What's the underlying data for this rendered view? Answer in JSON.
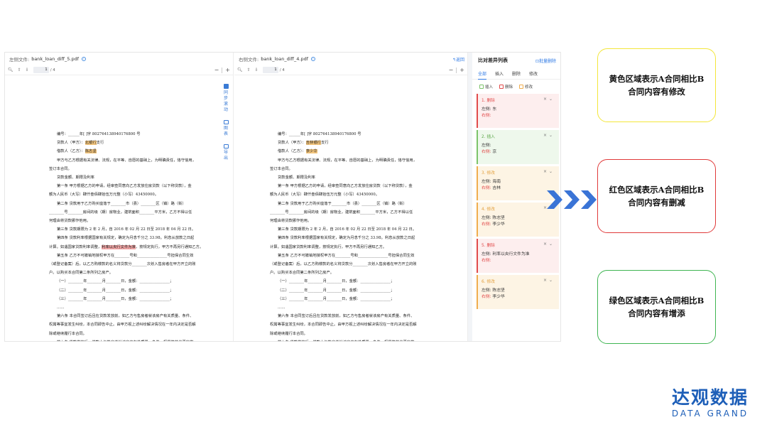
{
  "left_pane": {
    "label": "左侧文件:",
    "file_name": "bank_loan_diff_5.pdf",
    "page_current": "1",
    "page_total": "/ 4",
    "lines": [
      {
        "t": "编号：______年[ ]字 802764138940176800 号",
        "i": true
      },
      {
        "t": "贷款人（甲方）：",
        "hl": "北银行",
        "hlc": "y",
        "t2": "支行",
        "i": true
      },
      {
        "t": "借款人（乙方）：",
        "hl": "陈志坚",
        "hlc": "y",
        "t2": "",
        "i": true
      },
      {
        "t": "甲方与乙方根据有关法律、法规，在平等、自愿的基础上，为明确责任，恪守信用，",
        "i": true
      },
      {
        "t": "签订本合同。",
        "i": false
      },
      {
        "t": "贷款金额、期限及利率",
        "i": true
      },
      {
        "t": "第一条 甲方根据乙方的申请，经审查同意向乙方发放住房贷款（以下称贷款），金",
        "i": true
      },
      {
        "t": "额为人民币（大写）肆仟叁佰肆拾伍万元整（小写）43450000。",
        "i": false
      },
      {
        "t": "第二条 贷款用于乙方购买座落于________市（县）________区（镇）路（街）",
        "i": true
      },
      {
        "t": "________号________房间的级（期）房物业，建筑面积________平方米，乙方不得以任",
        "i": false
      },
      {
        "t": "何理由将贷款挪作他用。",
        "i": false
      },
      {
        "t": "第三条 贷款期限为 2 年 2 月，自 2016 年 02 月 22 日至 2018 年 04 月 22 日。",
        "i": true
      },
      {
        "t": "第四条 贷款利率根据国家有关规定，确定为月息千分之 33.98。利息从放款之日起",
        "i": true
      },
      {
        "t": "计算。如遇国家贷款利率调整，",
        "hl": "利率以央行文件为准",
        "hlc": "r",
        "t2": "，按规定执行，甲方不再另行通知乙方。",
        "i": false
      },
      {
        "t": "第五条 乙方不可撤销地授权甲方在________号和________________号担保合同生效",
        "i": true
      },
      {
        "t": "（或登记备案）后，以乙方购楼款的名义将贷款分________次划入售房者在甲方开立的账",
        "i": false
      },
      {
        "t": "户。以购买本合同第二条所列之房产。",
        "i": false
      },
      {
        "t": "（一）________年________月________日，金额：________________；",
        "i": true
      },
      {
        "t": "（二）________年________月________日，金额：________________；",
        "i": true
      },
      {
        "t": "（三）________年________月________日，金额：________________；",
        "i": true
      },
      {
        "t": "……",
        "i": true
      },
      {
        "t": "第六条 本合同签订后且在贷款发放前，如乙方与售房者就该房产有关质量、条件、",
        "i": true
      },
      {
        "t": "权属等事宜发生纠纷，本合同即告中止。由甲方视上述纠纷解决情况在一年内决定是否解",
        "i": false
      },
      {
        "t": "除或继续履行本合同。",
        "i": false
      },
      {
        "t": "第七条 贷款发放后，借款人与售房者就该房产有关质量、条件、权属等其他事宜发",
        "i": true
      },
      {
        "t": "生的任何纠纷，均与贷款人无关，借款合同应正常履行。",
        "i": false
      },
      {
        "t": "贷款的归还",
        "i": true
      },
      {
        "t": "第八条 甲乙双方商定，自 2018 年 11 月 10 日起乙方用下列方式归还贷款本息：",
        "i": true
      }
    ]
  },
  "right_pane": {
    "label": "右侧文件:",
    "file_name": "bank_loan_diff_4.pdf",
    "back_label": "返回",
    "page_current": "1",
    "page_total": "/ 4",
    "lines": [
      {
        "t": "编号：______年[ ]字 802764138940176800 号",
        "i": true
      },
      {
        "t": "贷款人（甲方）：",
        "hl": "吉林银行",
        "hlc": "y",
        "t2": "支行",
        "i": true
      },
      {
        "t": "借款人（乙方）：",
        "hl": "李少华",
        "hlc": "y",
        "t2": "",
        "i": true
      },
      {
        "t": "甲方与乙方根据有关法律、法规，在平等、自愿的基础上，为明确责任，恪守信用，",
        "i": true
      },
      {
        "t": "签订本合同。",
        "i": false
      },
      {
        "t": "贷款金额、期限及利率",
        "i": true
      },
      {
        "t": "第一条 甲方根据乙方的申请，经审查同意向乙方发放住房贷款（以下称贷款），金",
        "i": true
      },
      {
        "t": "额为人民币（大写）肆仟叁佰肆拾伍万元整（小写）43450000。",
        "i": false
      },
      {
        "t": "第二条 贷款用于乙方购买座落于________市（县）________区（镇）路（街）",
        "i": true
      },
      {
        "t": "________号________房间的级（期）房物业，建筑面积________平方米，乙方不得以任",
        "i": false
      },
      {
        "t": "何理由将贷款挪作他用。",
        "i": false
      },
      {
        "t": "第三条 贷款期限为 2 年 2 月，自 2016 年 02 月 22 日至 2018 年 04 月 22 日。",
        "i": true
      },
      {
        "t": "第四条 贷款利率根据国家有关规定，确定为月息千分之 33.98。利息从放款之日起",
        "i": true
      },
      {
        "t": "计算。如遇国家贷款利率调整，按规定执行，甲方不再另行通知乙方。",
        "i": false
      },
      {
        "t": "第五条 乙方不可撤销地授权甲方在________号和________________号担保合同生效",
        "i": true
      },
      {
        "t": "（或登记备案）后，以乙方购楼款的名义将贷款分________次划入售房者在甲方开立的账",
        "i": false
      },
      {
        "t": "户。以购买本合同第二条所列之房产。",
        "i": false
      },
      {
        "t": "（一）________年________月________日，金额：________________；",
        "i": true
      },
      {
        "t": "（二）________年________月________日，金额：________________；",
        "i": true
      },
      {
        "t": "（三）________年________月________日，金额：________________；",
        "i": true
      },
      {
        "t": "……",
        "i": true
      },
      {
        "t": "第六条 本合同签订后且在贷款发放前，如乙方与售房者就该房产有关质量、条件、",
        "i": true
      },
      {
        "t": "权属等事宜发生纠纷，本合同即告中止。由甲方视上述纠纷解决情况在一年内决定是否解",
        "i": false
      },
      {
        "t": "除或继续履行本合同。",
        "i": false
      },
      {
        "t": "第七条 贷款发放后，借款人与售房者就该房产有关质量、条件、权属等其他事宜发",
        "i": true
      },
      {
        "t": "生的任何纠纷，均与贷款人无关，借款合同应正常履行。",
        "i": false
      },
      {
        "t": "贷款的归还",
        "i": true
      },
      {
        "t": "第八条 甲乙双方商定，自 2018 年 11 月 10 日起乙方用下列方式归还贷款本息：",
        "i": true
      },
      {
        "t": "______________。",
        "i": false
      }
    ]
  },
  "vertical_tools": [
    {
      "label": "同步滚动",
      "icon": "checkbox-icon"
    },
    {
      "label": "图表",
      "icon": "chart-icon"
    },
    {
      "label": "导出",
      "icon": "export-icon"
    }
  ],
  "diff_panel": {
    "title": "比对差异列表",
    "batch_delete": "批量删除",
    "tabs": [
      "全部",
      "插入",
      "删除",
      "修改"
    ],
    "legend": [
      {
        "label": "插入",
        "color": "#7cc36a"
      },
      {
        "label": "删除",
        "color": "#e14b4b"
      },
      {
        "label": "修改",
        "color": "#f0ad4e"
      }
    ],
    "items": [
      {
        "title": "1. 删除",
        "type": "del",
        "left_label": "左侧:",
        "left": "东",
        "right_label": "右侧:",
        "right": ""
      },
      {
        "title": "2. 插入",
        "type": "ins",
        "left_label": "左侧:",
        "left": "",
        "right_label": "右侧:",
        "right": "京"
      },
      {
        "title": "3. 修改",
        "type": "mod",
        "left_label": "左侧:",
        "left": "海南",
        "right_label": "右侧:",
        "right": "吉林"
      },
      {
        "title": "4. 修改",
        "type": "mod",
        "left_label": "左侧:",
        "left": "陈志坚",
        "right_label": "右侧:",
        "right": "李少华"
      },
      {
        "title": "5. 删除",
        "type": "del",
        "left_label": "左侧:",
        "left": "利率以央行文件为准",
        "right_label": "右侧:",
        "right": ""
      },
      {
        "title": "6. 修改",
        "type": "mod",
        "left_label": "左侧:",
        "left": "陈志坚",
        "right_label": "右侧:",
        "right": "李少华"
      }
    ]
  },
  "notes": {
    "yellow": "黄色区域表示A合同相比B合同内容有修改",
    "red": "红色区域表示A合同相比B合同内容有删减",
    "green": "绿色区域表示A合同相比B合同内容有增添"
  },
  "logo": {
    "cn": "达观数据",
    "en": "DATA GRAND"
  },
  "colors": {
    "accent": "#2f7ae5",
    "arrow": "#3a74d6",
    "logo": "#1e5fb8"
  }
}
